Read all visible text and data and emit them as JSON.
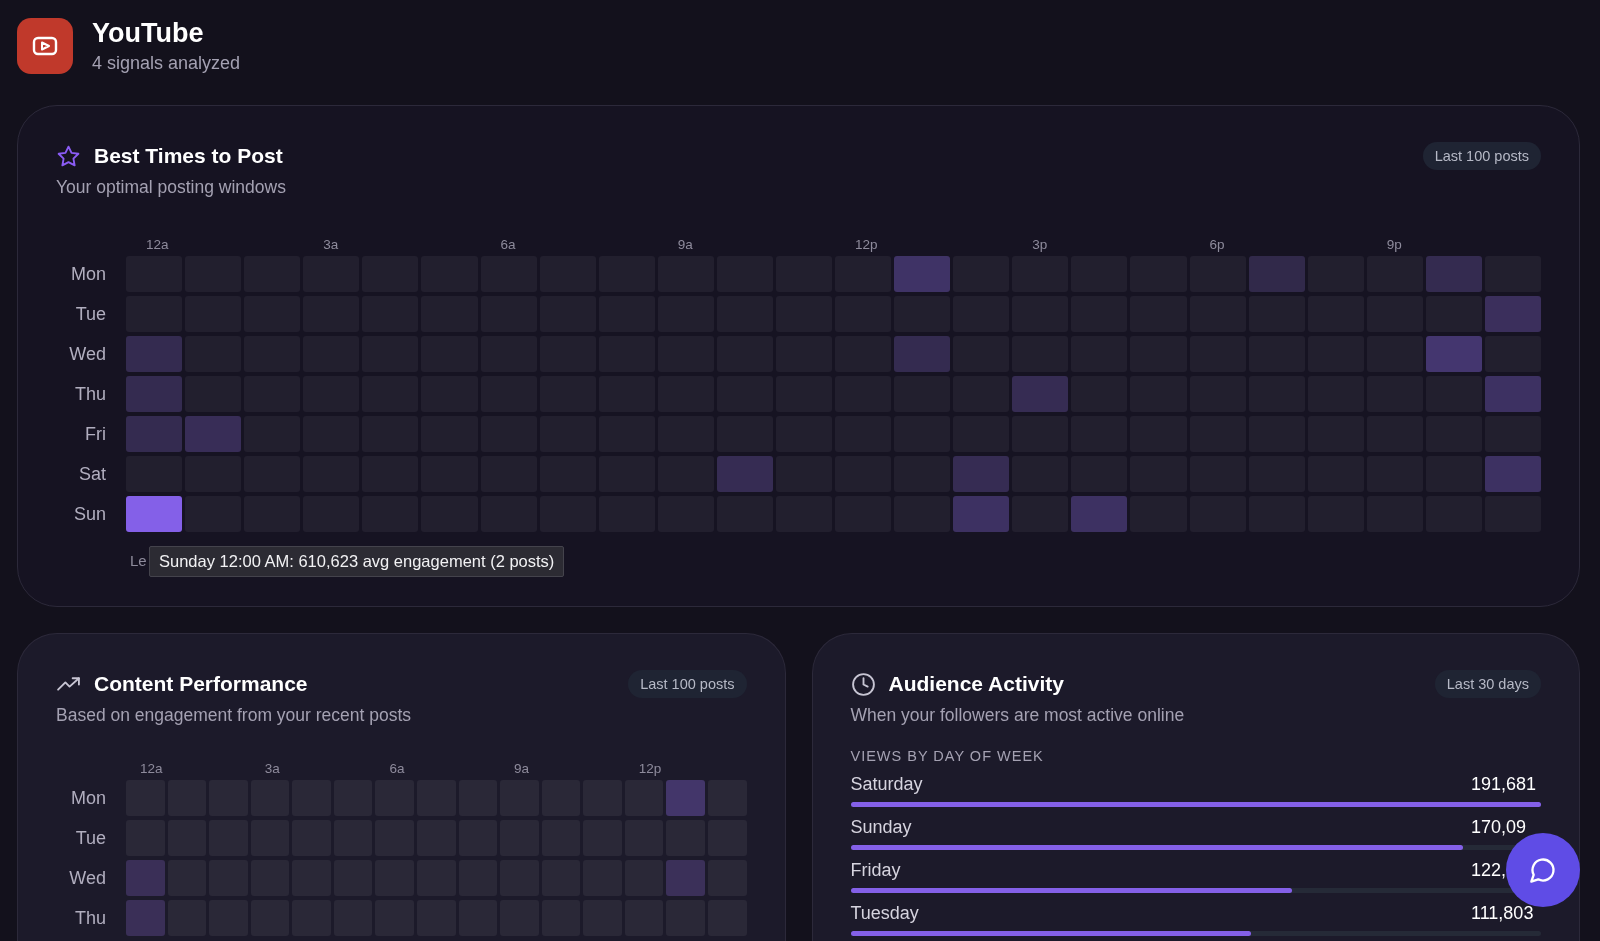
{
  "header": {
    "title": "YouTube",
    "subtitle": "4 signals analyzed"
  },
  "best_times": {
    "title": "Best Times to Post",
    "subtitle": "Your optimal posting windows",
    "badge": "Last 100 posts",
    "hour_labels": [
      "12a",
      "3a",
      "6a",
      "9a",
      "12p",
      "3p",
      "6p",
      "9p"
    ],
    "rows": [
      {
        "day": "Mon",
        "cells": [
          {
            "color": "#221f2e"
          },
          {
            "color": "#221f2e"
          },
          {
            "color": "#221f2e"
          },
          {
            "color": "#221f2e"
          },
          {
            "color": "#221f2e"
          },
          {
            "color": "#221f2e"
          },
          {
            "color": "#221f2e"
          },
          {
            "color": "#221f2e"
          },
          {
            "color": "#221f2e"
          },
          {
            "color": "#221f2e"
          },
          {
            "color": "#221f2e"
          },
          {
            "color": "#221f2e"
          },
          {
            "color": "#221f2e"
          },
          {
            "color": "#3f3366"
          },
          {
            "color": "#221f2e"
          },
          {
            "color": "#221f2e"
          },
          {
            "color": "#221f2e"
          },
          {
            "color": "#221f2e"
          },
          {
            "color": "#221f2e"
          },
          {
            "color": "#31294a"
          },
          {
            "color": "#221f2e"
          },
          {
            "color": "#221f2e"
          },
          {
            "color": "#342b50"
          },
          {
            "color": "#221f2e"
          }
        ]
      },
      {
        "day": "Tue",
        "cells": [
          {
            "color": "#221f2e"
          },
          {
            "color": "#221f2e"
          },
          {
            "color": "#221f2e"
          },
          {
            "color": "#221f2e"
          },
          {
            "color": "#221f2e"
          },
          {
            "color": "#221f2e"
          },
          {
            "color": "#221f2e"
          },
          {
            "color": "#221f2e"
          },
          {
            "color": "#221f2e"
          },
          {
            "color": "#221f2e"
          },
          {
            "color": "#221f2e"
          },
          {
            "color": "#221f2e"
          },
          {
            "color": "#221f2e"
          },
          {
            "color": "#221f2e"
          },
          {
            "color": "#221f2e"
          },
          {
            "color": "#221f2e"
          },
          {
            "color": "#221f2e"
          },
          {
            "color": "#221f2e"
          },
          {
            "color": "#221f2e"
          },
          {
            "color": "#221f2e"
          },
          {
            "color": "#221f2e"
          },
          {
            "color": "#221f2e"
          },
          {
            "color": "#221f2e"
          },
          {
            "color": "#3b2f5c"
          }
        ]
      },
      {
        "day": "Wed",
        "cells": [
          {
            "color": "#342b50"
          },
          {
            "color": "#221f2e"
          },
          {
            "color": "#221f2e"
          },
          {
            "color": "#221f2e"
          },
          {
            "color": "#221f2e"
          },
          {
            "color": "#221f2e"
          },
          {
            "color": "#221f2e"
          },
          {
            "color": "#221f2e"
          },
          {
            "color": "#221f2e"
          },
          {
            "color": "#221f2e"
          },
          {
            "color": "#221f2e"
          },
          {
            "color": "#221f2e"
          },
          {
            "color": "#221f2e"
          },
          {
            "color": "#342b50"
          },
          {
            "color": "#221f2e"
          },
          {
            "color": "#221f2e"
          },
          {
            "color": "#221f2e"
          },
          {
            "color": "#221f2e"
          },
          {
            "color": "#221f2e"
          },
          {
            "color": "#221f2e"
          },
          {
            "color": "#221f2e"
          },
          {
            "color": "#221f2e"
          },
          {
            "color": "#44366f"
          },
          {
            "color": "#221f2e"
          }
        ]
      },
      {
        "day": "Thu",
        "cells": [
          {
            "color": "#342b50"
          },
          {
            "color": "#221f2e"
          },
          {
            "color": "#221f2e"
          },
          {
            "color": "#221f2e"
          },
          {
            "color": "#221f2e"
          },
          {
            "color": "#221f2e"
          },
          {
            "color": "#221f2e"
          },
          {
            "color": "#221f2e"
          },
          {
            "color": "#221f2e"
          },
          {
            "color": "#221f2e"
          },
          {
            "color": "#221f2e"
          },
          {
            "color": "#221f2e"
          },
          {
            "color": "#221f2e"
          },
          {
            "color": "#221f2e"
          },
          {
            "color": "#221f2e"
          },
          {
            "color": "#362c53"
          },
          {
            "color": "#221f2e"
          },
          {
            "color": "#221f2e"
          },
          {
            "color": "#221f2e"
          },
          {
            "color": "#221f2e"
          },
          {
            "color": "#221f2e"
          },
          {
            "color": "#221f2e"
          },
          {
            "color": "#221f2e"
          },
          {
            "color": "#3d3162"
          }
        ]
      },
      {
        "day": "Fri",
        "cells": [
          {
            "color": "#342b50"
          },
          {
            "color": "#382d57"
          },
          {
            "color": "#221f2e"
          },
          {
            "color": "#221f2e"
          },
          {
            "color": "#221f2e"
          },
          {
            "color": "#221f2e"
          },
          {
            "color": "#221f2e"
          },
          {
            "color": "#221f2e"
          },
          {
            "color": "#221f2e"
          },
          {
            "color": "#221f2e"
          },
          {
            "color": "#221f2e"
          },
          {
            "color": "#221f2e"
          },
          {
            "color": "#221f2e"
          },
          {
            "color": "#221f2e"
          },
          {
            "color": "#221f2e"
          },
          {
            "color": "#221f2e"
          },
          {
            "color": "#221f2e"
          },
          {
            "color": "#221f2e"
          },
          {
            "color": "#221f2e"
          },
          {
            "color": "#221f2e"
          },
          {
            "color": "#221f2e"
          },
          {
            "color": "#221f2e"
          },
          {
            "color": "#221f2e"
          },
          {
            "color": "#221f2e"
          }
        ]
      },
      {
        "day": "Sat",
        "cells": [
          {
            "color": "#221f2e"
          },
          {
            "color": "#221f2e"
          },
          {
            "color": "#221f2e"
          },
          {
            "color": "#221f2e"
          },
          {
            "color": "#221f2e"
          },
          {
            "color": "#221f2e"
          },
          {
            "color": "#221f2e"
          },
          {
            "color": "#221f2e"
          },
          {
            "color": "#221f2e"
          },
          {
            "color": "#221f2e"
          },
          {
            "color": "#362c53"
          },
          {
            "color": "#221f2e"
          },
          {
            "color": "#221f2e"
          },
          {
            "color": "#221f2e"
          },
          {
            "color": "#362c53"
          },
          {
            "color": "#221f2e"
          },
          {
            "color": "#221f2e"
          },
          {
            "color": "#221f2e"
          },
          {
            "color": "#221f2e"
          },
          {
            "color": "#221f2e"
          },
          {
            "color": "#221f2e"
          },
          {
            "color": "#221f2e"
          },
          {
            "color": "#221f2e"
          },
          {
            "color": "#3d3162"
          }
        ]
      },
      {
        "day": "Sun",
        "cells": [
          {
            "color": "#8460e8"
          },
          {
            "color": "#221f2e"
          },
          {
            "color": "#221f2e"
          },
          {
            "color": "#221f2e"
          },
          {
            "color": "#221f2e"
          },
          {
            "color": "#221f2e"
          },
          {
            "color": "#221f2e"
          },
          {
            "color": "#221f2e"
          },
          {
            "color": "#221f2e"
          },
          {
            "color": "#221f2e"
          },
          {
            "color": "#221f2e"
          },
          {
            "color": "#221f2e"
          },
          {
            "color": "#221f2e"
          },
          {
            "color": "#221f2e"
          },
          {
            "color": "#3d3162"
          },
          {
            "color": "#221f2e"
          },
          {
            "color": "#3d3162"
          },
          {
            "color": "#221f2e"
          },
          {
            "color": "#221f2e"
          },
          {
            "color": "#221f2e"
          },
          {
            "color": "#221f2e"
          },
          {
            "color": "#221f2e"
          },
          {
            "color": "#221f2e"
          },
          {
            "color": "#221f2e"
          }
        ]
      }
    ],
    "legend": "Le",
    "tooltip": "Sunday 12:00 AM: 610,623 avg engagement (2 posts)"
  },
  "content_performance": {
    "title": "Content Performance",
    "subtitle": "Based on engagement from your recent posts",
    "badge": "Last 100 posts",
    "hour_labels": [
      "12a",
      "3a",
      "6a",
      "9a",
      "12p"
    ],
    "rows": [
      {
        "day": "Mon",
        "cells": [
          {
            "color": "#2a2837"
          },
          {
            "color": "#2a2837"
          },
          {
            "color": "#2a2837"
          },
          {
            "color": "#2a2837"
          },
          {
            "color": "#2a2837"
          },
          {
            "color": "#2a2837"
          },
          {
            "color": "#2a2837"
          },
          {
            "color": "#2a2837"
          },
          {
            "color": "#2a2837"
          },
          {
            "color": "#2a2837"
          },
          {
            "color": "#2a2837"
          },
          {
            "color": "#2a2837"
          },
          {
            "color": "#2a2837"
          },
          {
            "color": "#43366a"
          },
          {
            "color": "#2a2837"
          }
        ]
      },
      {
        "day": "Tue",
        "cells": [
          {
            "color": "#2a2837"
          },
          {
            "color": "#2a2837"
          },
          {
            "color": "#2a2837"
          },
          {
            "color": "#2a2837"
          },
          {
            "color": "#2a2837"
          },
          {
            "color": "#2a2837"
          },
          {
            "color": "#2a2837"
          },
          {
            "color": "#2a2837"
          },
          {
            "color": "#2a2837"
          },
          {
            "color": "#2a2837"
          },
          {
            "color": "#2a2837"
          },
          {
            "color": "#2a2837"
          },
          {
            "color": "#2a2837"
          },
          {
            "color": "#2a2837"
          },
          {
            "color": "#2a2837"
          }
        ]
      },
      {
        "day": "Wed",
        "cells": [
          {
            "color": "#3a2f57"
          },
          {
            "color": "#2a2837"
          },
          {
            "color": "#2a2837"
          },
          {
            "color": "#2a2837"
          },
          {
            "color": "#2a2837"
          },
          {
            "color": "#2a2837"
          },
          {
            "color": "#2a2837"
          },
          {
            "color": "#2a2837"
          },
          {
            "color": "#2a2837"
          },
          {
            "color": "#2a2837"
          },
          {
            "color": "#2a2837"
          },
          {
            "color": "#2a2837"
          },
          {
            "color": "#2a2837"
          },
          {
            "color": "#3b3059"
          },
          {
            "color": "#2a2837"
          }
        ]
      },
      {
        "day": "Thu",
        "cells": [
          {
            "color": "#3a2f57"
          },
          {
            "color": "#2a2837"
          },
          {
            "color": "#2a2837"
          },
          {
            "color": "#2a2837"
          },
          {
            "color": "#2a2837"
          },
          {
            "color": "#2a2837"
          },
          {
            "color": "#2a2837"
          },
          {
            "color": "#2a2837"
          },
          {
            "color": "#2a2837"
          },
          {
            "color": "#2a2837"
          },
          {
            "color": "#2a2837"
          },
          {
            "color": "#2a2837"
          },
          {
            "color": "#2a2837"
          },
          {
            "color": "#2a2837"
          },
          {
            "color": "#2a2837"
          }
        ]
      }
    ]
  },
  "audience_activity": {
    "title": "Audience Activity",
    "subtitle": "When your followers are most active online",
    "badge": "Last 30 days",
    "section_label": "VIEWS BY DAY OF WEEK",
    "days": [
      {
        "day": "Saturday",
        "value": "191,681",
        "level": 1
      },
      {
        "day": "Sunday",
        "value": "170,09",
        "level": 0.887
      },
      {
        "day": "Friday",
        "value": "122,",
        "level": 0.64
      },
      {
        "day": "Tuesday",
        "value": "111,803",
        "level": 0.58
      }
    ]
  }
}
